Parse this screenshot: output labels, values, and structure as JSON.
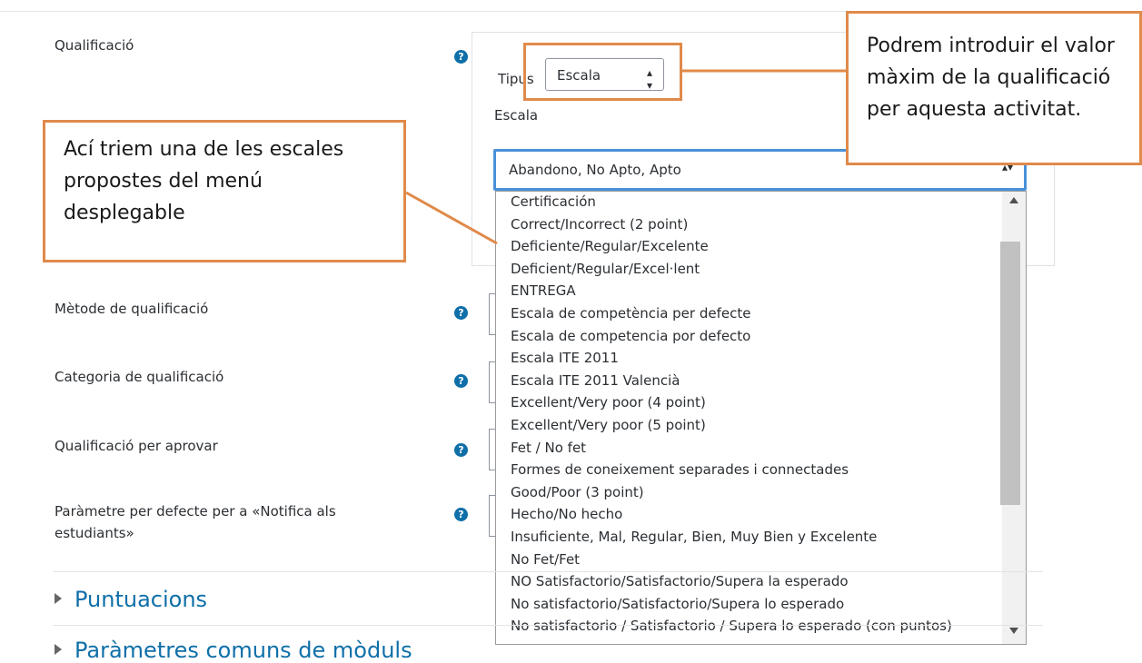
{
  "fields": {
    "qualificacio": "Qualificació",
    "metode": "Mètode de qualificació",
    "categoria": "Categoria de qualificació",
    "aprovar": "Qualificació per aprovar",
    "notifica": "Paràmetre per defecte per a «Notifica als estudiants»"
  },
  "grade": {
    "tipus_label": "Tipus",
    "tipus_value": "Escala",
    "escala_label": "Escala",
    "escala_value": "Abandono, No Apto, Apto",
    "options": [
      "Certificación",
      "Correct/Incorrect (2 point)",
      "Deficiente/Regular/Excelente",
      "Deficient/Regular/Excel·lent",
      "ENTREGA",
      "Escala de competència per defecte",
      "Escala de competencia por defecto",
      "Escala ITE 2011",
      "Escala ITE 2011 Valencià",
      "Excellent/Very poor (4 point)",
      "Excellent/Very poor (5 point)",
      "Fet / No fet",
      "Formes de coneixement separades i connectades",
      "Good/Poor (3 point)",
      "Hecho/No hecho",
      "Insuficiente, Mal, Regular, Bien, Muy Bien y Excelente",
      "No Fet/Fet",
      "NO Satisfactorio/Satisfactorio/Supera la esperado",
      "No satisfactorio/Satisfactorio/Supera lo esperado",
      "No satisfactorio / Satisfactorio / Supera lo esperado (con puntos)"
    ]
  },
  "sections": {
    "puntuacions": "Puntuacions",
    "parametres": "Paràmetres comuns de mòduls"
  },
  "callouts": {
    "left": "Ací triem una de les escales propostes del menú desplegable",
    "right": "Podrem introduir el valor màxim de la qualificació per aquesta activitat."
  },
  "colors": {
    "link_blue": "#0f6fa8",
    "annotation_orange": "#e08a4a",
    "focus_blue": "#4a90d9"
  }
}
